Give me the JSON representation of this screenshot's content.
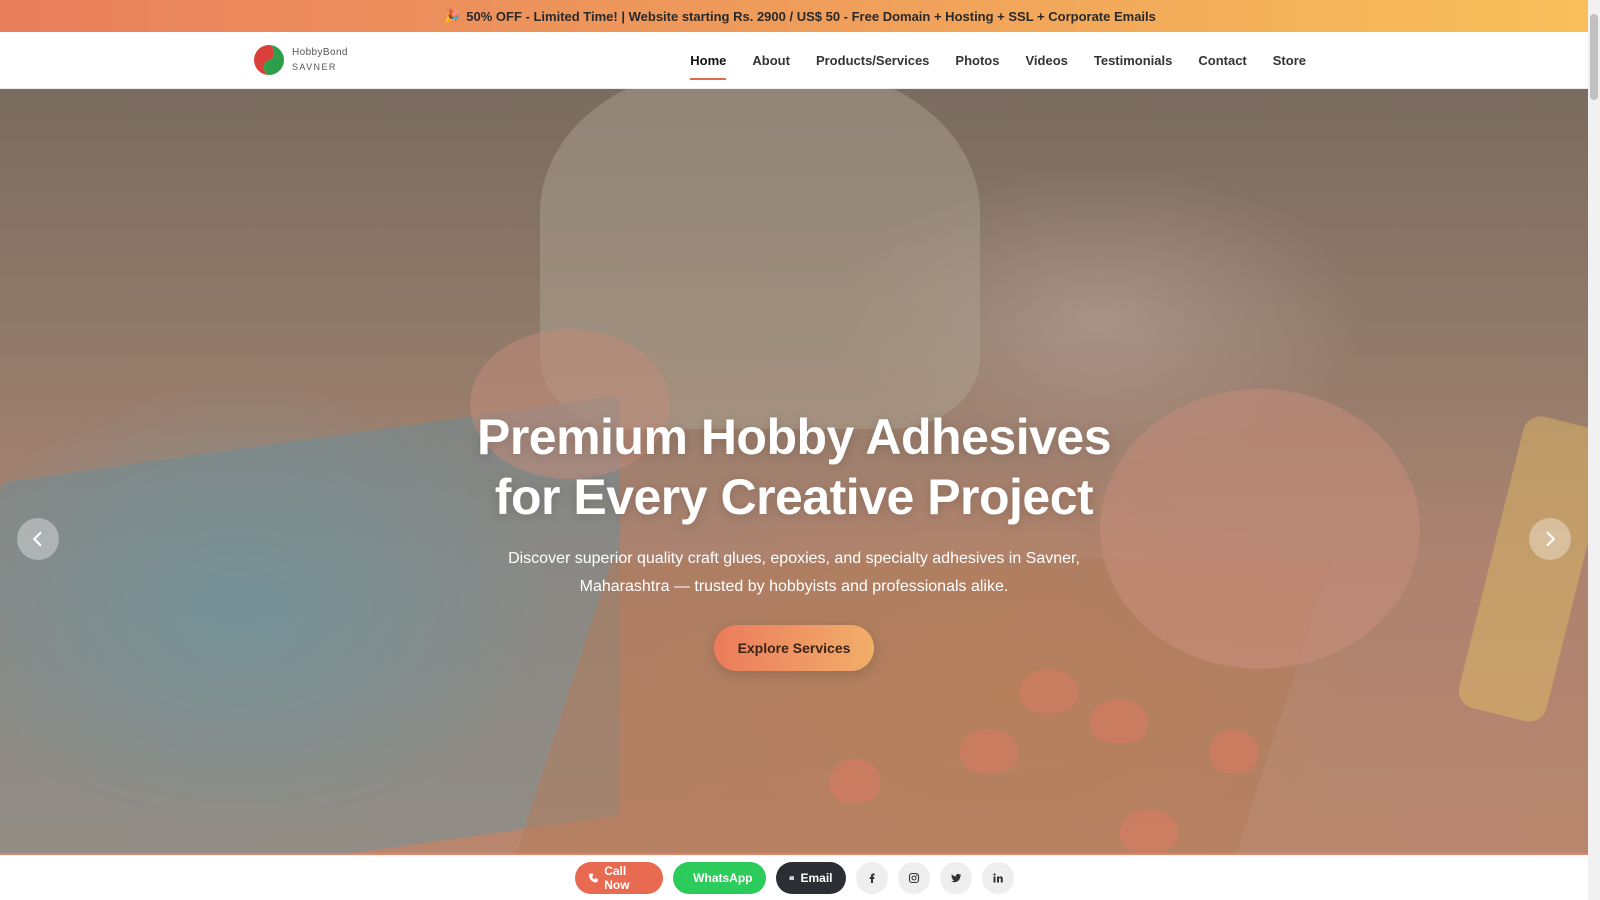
{
  "promo": {
    "icon": "party-popper-icon",
    "text": "50% OFF - Limited Time! | Website starting Rs. 2900 / US$ 50 - Free Domain + Hosting + SSL + Corporate Emails"
  },
  "brand": {
    "name": "HobbyBond",
    "location": "SAVNER",
    "logo_colors": {
      "left": "#d9403a",
      "right": "#2e9e4a"
    }
  },
  "nav": {
    "items": [
      {
        "label": "Home",
        "active": true
      },
      {
        "label": "About",
        "active": false
      },
      {
        "label": "Products/Services",
        "active": false
      },
      {
        "label": "Photos",
        "active": false
      },
      {
        "label": "Videos",
        "active": false
      },
      {
        "label": "Testimonials",
        "active": false
      },
      {
        "label": "Contact",
        "active": false
      },
      {
        "label": "Store",
        "active": false
      }
    ]
  },
  "hero": {
    "title_line1": "Premium Hobby Adhesives",
    "title_line2": "for Every Creative Project",
    "subtitle": "Discover superior quality craft glues, epoxies, and specialty adhesives in Savner, Maharashtra — trusted by hobbyists and professionals alike.",
    "cta_label": "Explore Services",
    "prev_icon": "chevron-left-icon",
    "next_icon": "chevron-right-icon"
  },
  "actions": {
    "call_label": "Call Now",
    "whatsapp_label": "WhatsApp",
    "email_label": "Email",
    "social": [
      "facebook-icon",
      "instagram-icon",
      "twitter-icon",
      "linkedin-icon"
    ]
  },
  "colors": {
    "accent": "#e06c4f",
    "call": "#e86a50",
    "whatsapp": "#2bcc5b",
    "email": "#2b2f33"
  }
}
